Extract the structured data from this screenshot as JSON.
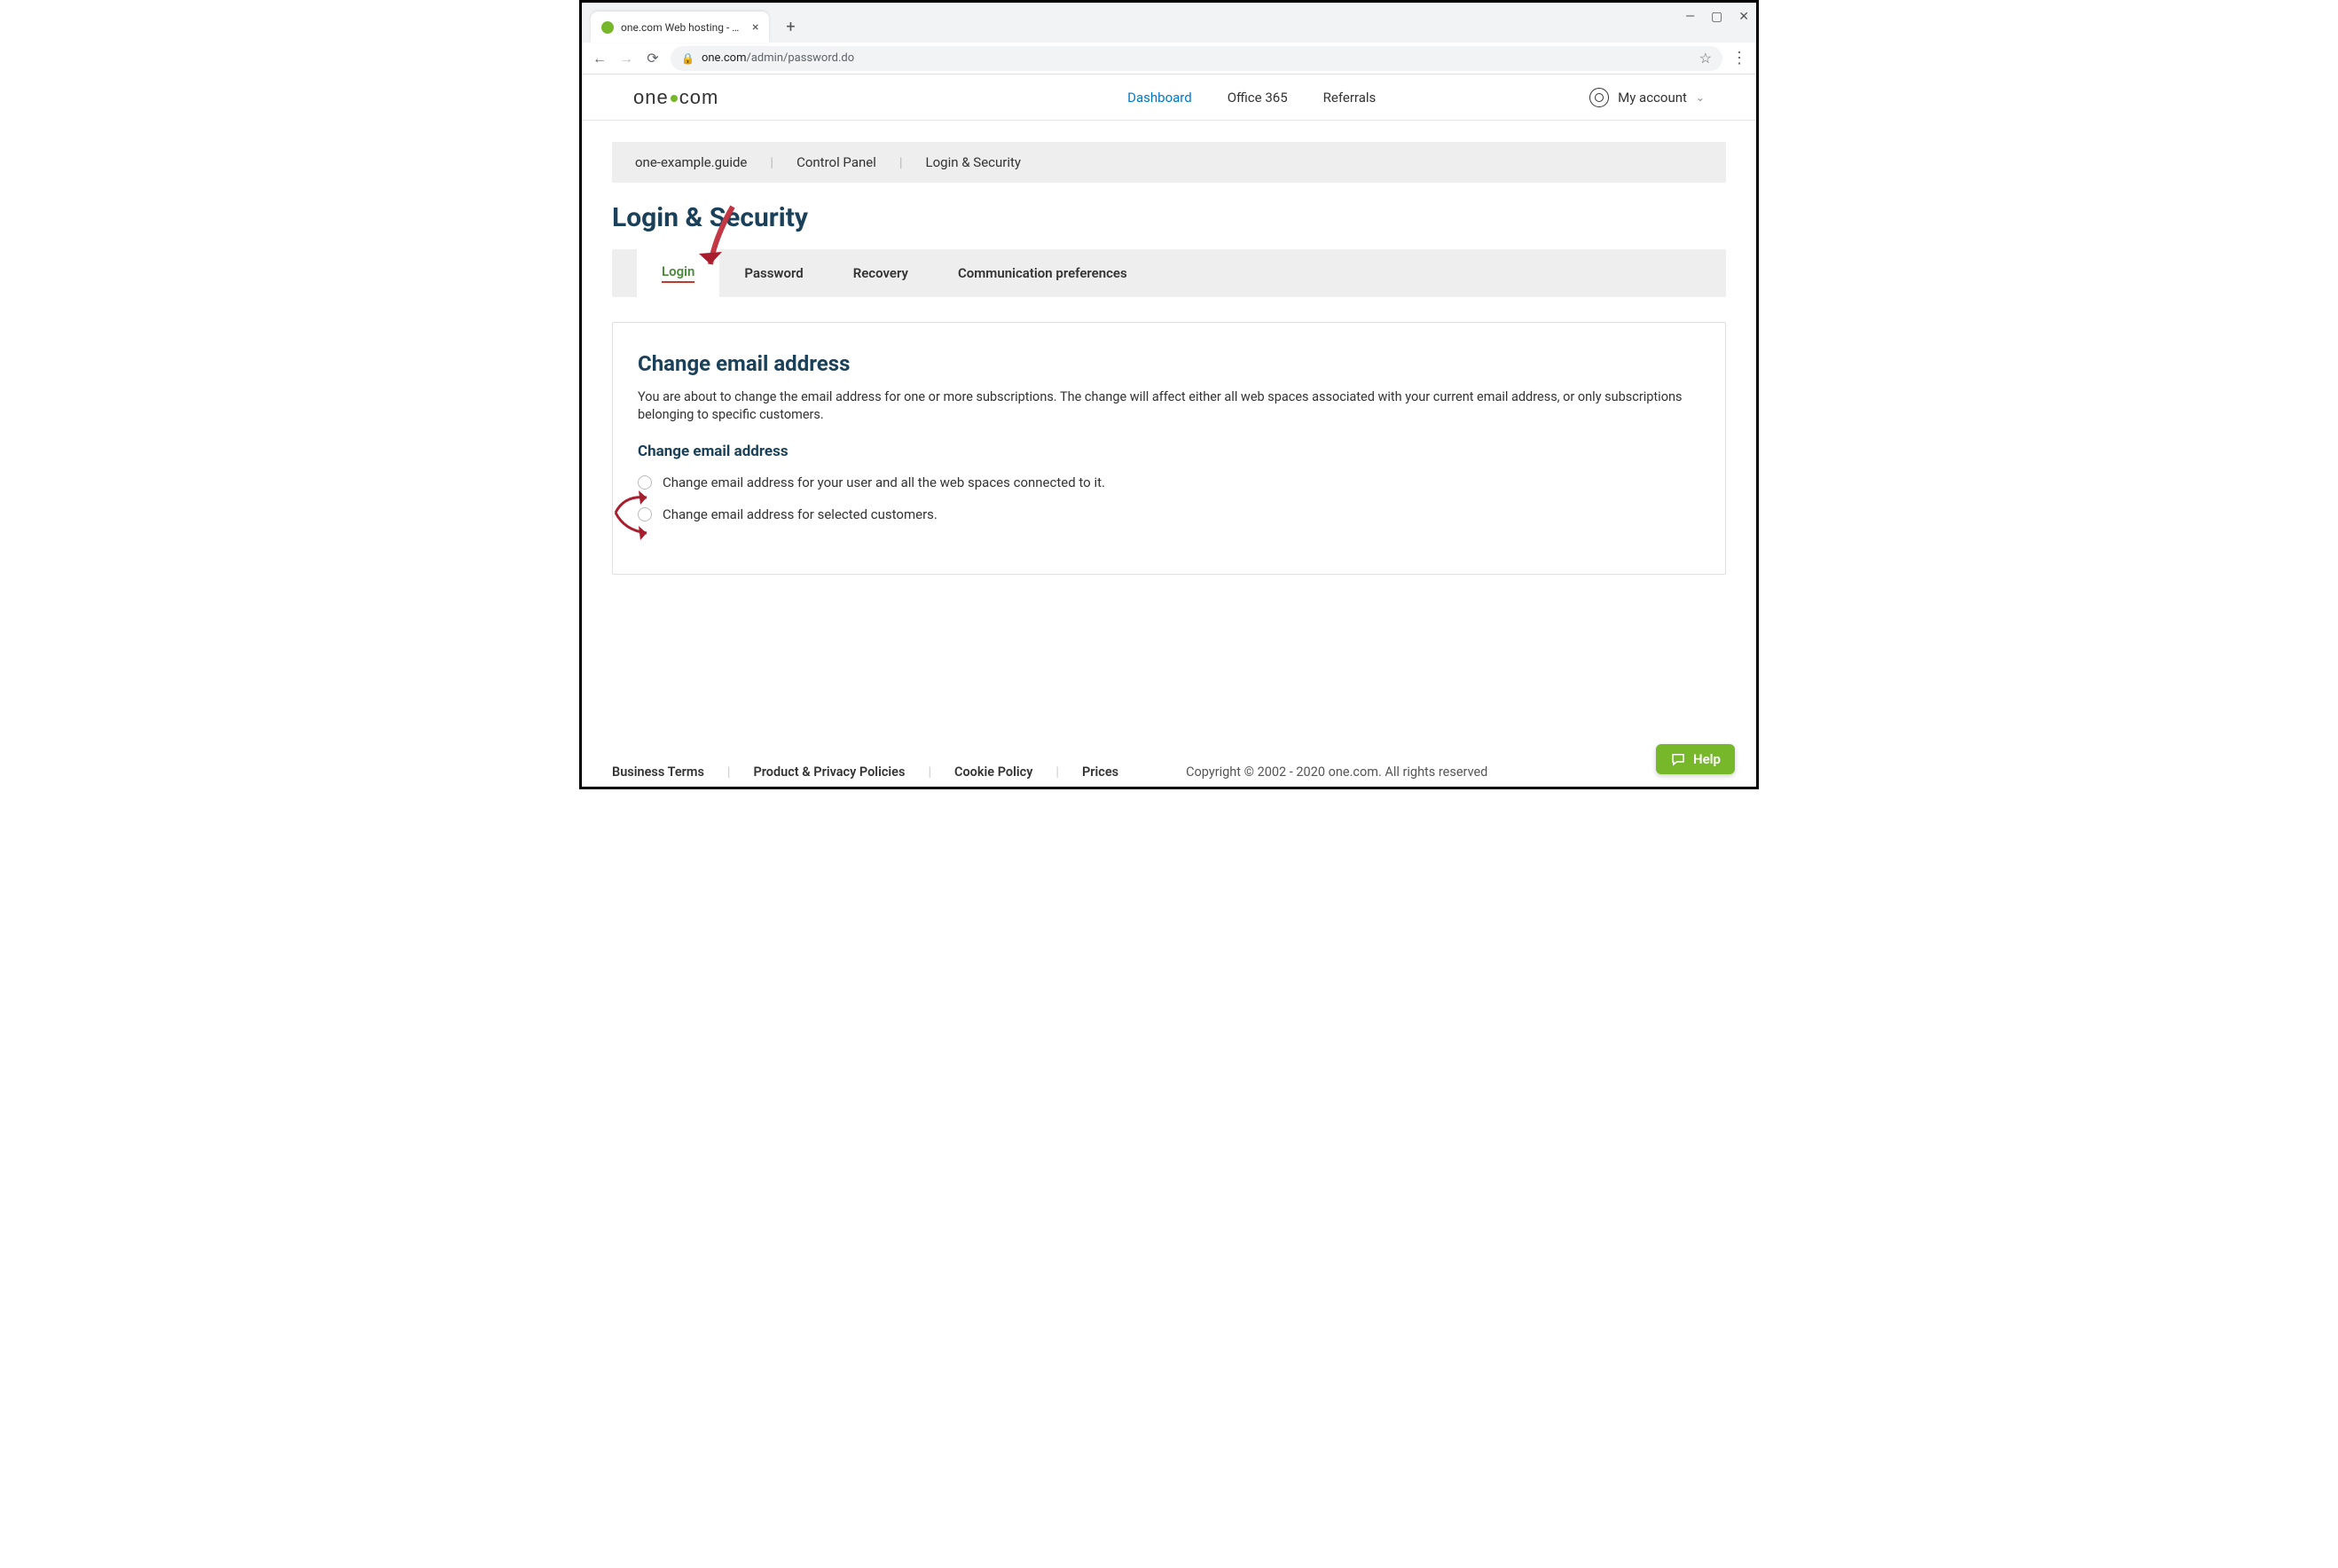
{
  "browser": {
    "tab_title": "one.com Web hosting  -  Domain",
    "url_host": "one.com",
    "url_path": "/admin/password.do"
  },
  "header": {
    "nav": {
      "dashboard": "Dashboard",
      "office365": "Office 365",
      "referrals": "Referrals"
    },
    "account_label": "My account"
  },
  "breadcrumb": {
    "domain": "one-example.guide",
    "cp": "Control Panel",
    "page": "Login & Security"
  },
  "page_title": "Login & Security",
  "tabs": {
    "login": "Login",
    "password": "Password",
    "recovery": "Recovery",
    "comm": "Communication preferences"
  },
  "panel": {
    "heading": "Change email address",
    "intro": "You are about to change the email address for one or more subscriptions. The change will affect either all web spaces associated with your current email address, or only subscriptions belonging to specific customers.",
    "subheading": "Change email address",
    "option1": "Change email address for your user and all the web spaces connected to it.",
    "option2": "Change email address for selected customers."
  },
  "footer": {
    "terms": "Business Terms",
    "privacy": "Product & Privacy Policies",
    "cookie": "Cookie Policy",
    "prices": "Prices",
    "copyright": "Copyright © 2002 - 2020 one.com. All rights reserved"
  },
  "help_label": "Help"
}
